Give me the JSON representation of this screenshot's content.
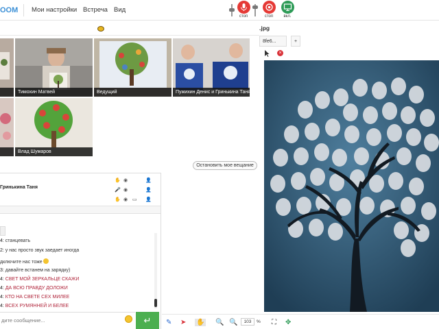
{
  "topbar": {
    "logo": "OOM",
    "menu": [
      "Мои настройки",
      "Встреча",
      "Вид"
    ],
    "mic_label": "стоп",
    "cam_label": "стоп",
    "screen_label": "вкл."
  },
  "videos": [
    {
      "name": ""
    },
    {
      "name": "Тимохин Матвей"
    },
    {
      "name": "Ведущий"
    },
    {
      "name": "Пужихин Денис и Гринькина Таня"
    },
    {
      "name": ""
    },
    {
      "name": "Влад Шумаров"
    }
  ],
  "stop_broadcast": "Остановить мое вещание",
  "participants": [
    {
      "name": ""
    },
    {
      "name": "Гринькина Таня"
    },
    {
      "name": ""
    }
  ],
  "chat": [
    {
      "who": "4:",
      "msg": "станцевать",
      "red": false
    },
    {
      "who": "2:",
      "msg": "у нас просто звук заедает иногда",
      "red": false
    },
    {
      "who": "",
      "msg": "дключите нас тоже",
      "red": false
    },
    {
      "who": "3:",
      "msg": "давайте встанем на зарядку)",
      "red": false
    },
    {
      "who": "4:",
      "msg": "СВЕТ МОЙ ЗЕРКАЛЬЦЕ СКАЖИ",
      "red": true
    },
    {
      "who": "4:",
      "msg": "ДА ВСЮ ПРАВДУ ДОЛОЖИ",
      "red": true
    },
    {
      "who": "4:",
      "msg": "КТО НА СВЕТЕ СЕХ МИЛЕЕ",
      "red": true
    },
    {
      "who": "4:",
      "msg": "ВСЕХ РУМЯННЕЙ И БЕЛЕЕ",
      "red": true
    }
  ],
  "chat_input": {
    "placeholder": "дите сообщение..."
  },
  "whiteboard": {
    "title": ".jpg",
    "tab_name": "8fe6...",
    "add_tab": "+",
    "zoom": "103",
    "zoom_unit": "%"
  },
  "colors": {
    "accent_green": "#4caf50",
    "stop_red": "#e53935",
    "screen_green": "#2e9b57",
    "chat_red": "#b0243a"
  }
}
